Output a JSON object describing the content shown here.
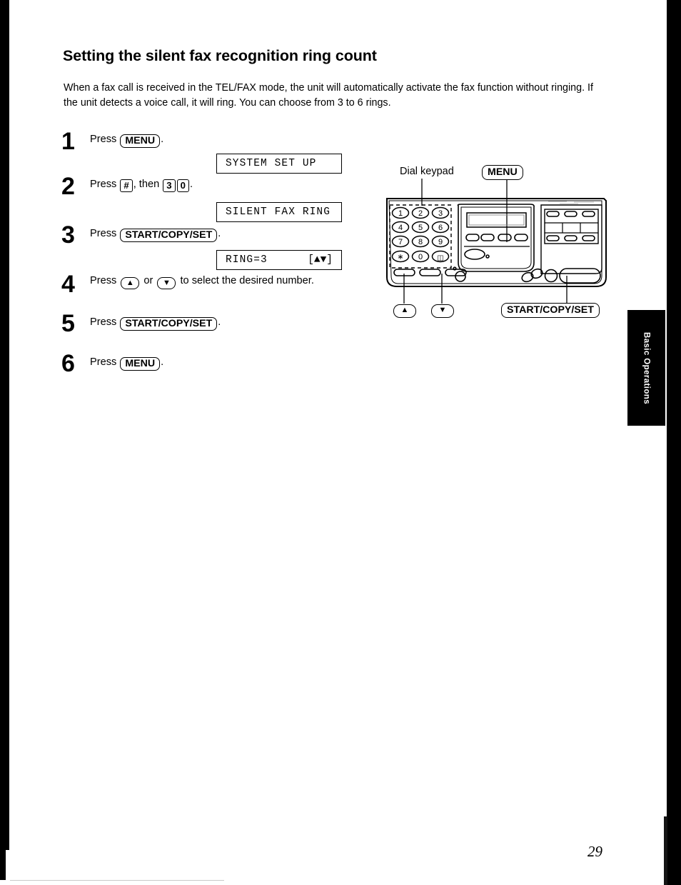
{
  "page": {
    "heading": "Setting the silent fax recognition ring count",
    "intro": "When a fax call is received in the TEL/FAX mode, the unit will automatically activate the fax function without ringing. If the unit detects a voice call, it will ring. You can choose from 3 to 6 rings.",
    "number": "29",
    "side_tab": "Basic Operations"
  },
  "steps": [
    {
      "number": "1",
      "prefix": "Press ",
      "key": "MENU",
      "suffix": "."
    },
    {
      "number": "2",
      "prefix": "Press ",
      "key_hash": "#",
      "mid": ", then ",
      "key_3": "3",
      "key_0": "0",
      "suffix": "."
    },
    {
      "number": "3",
      "prefix": "Press ",
      "key": "START/COPY/SET",
      "suffix": "."
    },
    {
      "number": "4",
      "prefix": "Press ",
      "key_up": "▲",
      "mid": " or ",
      "key_down": "▼",
      "suffix": " to select the desired number."
    },
    {
      "number": "5",
      "prefix": "Press ",
      "key": "START/COPY/SET",
      "suffix": "."
    },
    {
      "number": "6",
      "prefix": "Press ",
      "key": "MENU",
      "suffix": "."
    }
  ],
  "displays": [
    {
      "left": "SYSTEM SET UP",
      "right": ""
    },
    {
      "left": "SILENT FAX RING",
      "right": ""
    },
    {
      "left": "RING=3",
      "right": "[▲▼]"
    }
  ],
  "figure": {
    "label_keypad": "Dial keypad",
    "key_menu": "MENU",
    "key_up": "▲",
    "key_down": "▼",
    "key_start": "START/COPY/SET",
    "keypad_rows": [
      [
        "1",
        "2",
        "3"
      ],
      [
        "4",
        "5",
        "6"
      ],
      [
        "7",
        "8",
        "9"
      ],
      [
        "∗",
        "0",
        "⧉"
      ]
    ]
  }
}
